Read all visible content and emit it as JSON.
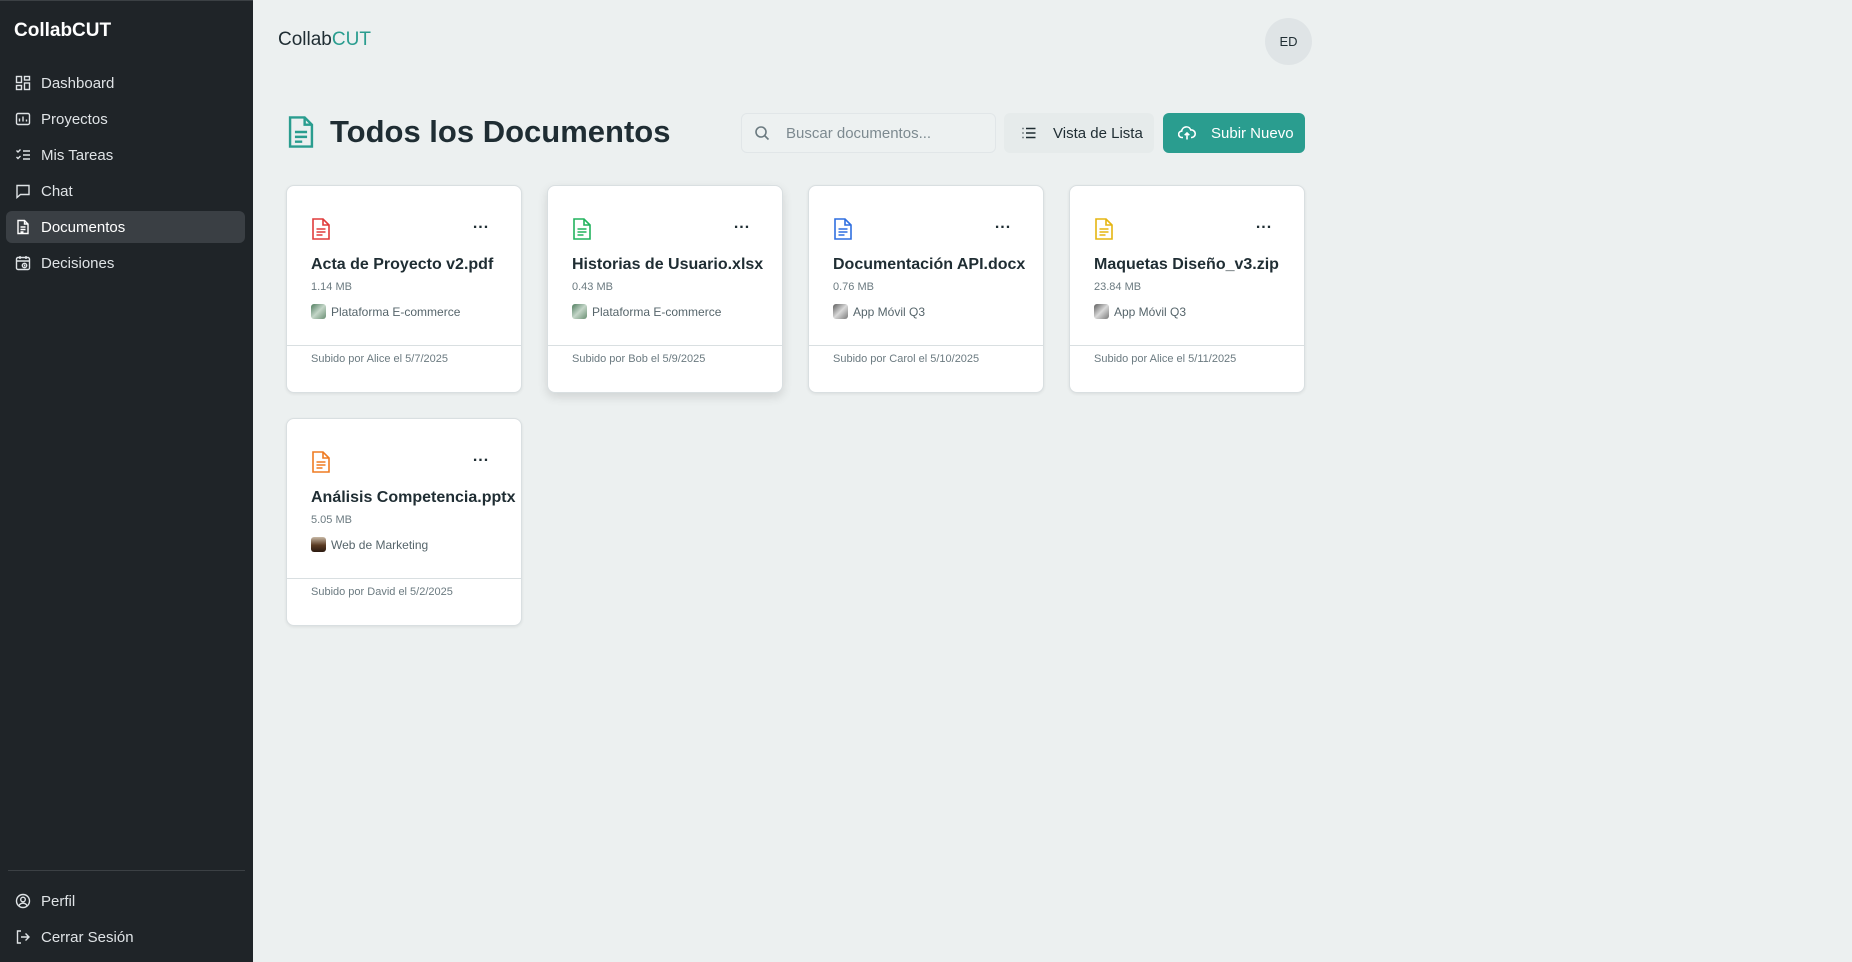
{
  "sidebar": {
    "brand": "CollabCUT",
    "items": [
      {
        "label": "Dashboard",
        "icon": "dashboard-icon"
      },
      {
        "label": "Proyectos",
        "icon": "projects-icon"
      },
      {
        "label": "Mis Tareas",
        "icon": "tasks-icon"
      },
      {
        "label": "Chat",
        "icon": "chat-icon"
      },
      {
        "label": "Documentos",
        "icon": "documents-icon",
        "active": true
      },
      {
        "label": "Decisiones",
        "icon": "decisions-icon"
      }
    ],
    "bottom": [
      {
        "label": "Perfil",
        "icon": "profile-icon"
      },
      {
        "label": "Cerrar Sesión",
        "icon": "logout-icon"
      }
    ]
  },
  "header": {
    "brand_main": "Collab",
    "brand_accent": "CUT",
    "avatar_initials": "ED"
  },
  "main": {
    "title": "Todos los Documentos",
    "search_placeholder": "Buscar documentos...",
    "list_view_label": "Vista de Lista",
    "upload_label": "Subir Nuevo"
  },
  "colors": {
    "accent": "#2a9d8f",
    "sidebar_bg": "#1f2428",
    "pdf": "#e03b3b",
    "xlsx": "#22b35e",
    "docx": "#2f6fe0",
    "zip": "#e5b511",
    "pptx": "#ef7b22"
  },
  "documents": [
    {
      "name": "Acta de Proyecto v2.pdf",
      "size": "1.14 MB",
      "project": "Plataforma E-commerce",
      "uploaded": "Subido por Alice el 5/7/2025",
      "icon_color": "#e03b3b",
      "more": "..."
    },
    {
      "name": "Historias de Usuario.xlsx",
      "size": "0.43 MB",
      "project": "Plataforma E-commerce",
      "uploaded": "Subido por Bob el 5/9/2025",
      "icon_color": "#22b35e",
      "more": "..."
    },
    {
      "name": "Documentación API.docx",
      "size": "0.76 MB",
      "project": "App Móvil Q3",
      "uploaded": "Subido por Carol el 5/10/2025",
      "icon_color": "#2f6fe0",
      "more": "..."
    },
    {
      "name": "Maquetas Diseño_v3.zip",
      "size": "23.84 MB",
      "project": "App Móvil Q3",
      "uploaded": "Subido por Alice el 5/11/2025",
      "icon_color": "#e5b511",
      "more": "..."
    },
    {
      "name": "Análisis Competencia.pptx",
      "size": "5.05 MB",
      "project": "Web de Marketing",
      "uploaded": "Subido por David el 5/2/2025",
      "icon_color": "#ef7b22",
      "more": "..."
    }
  ]
}
